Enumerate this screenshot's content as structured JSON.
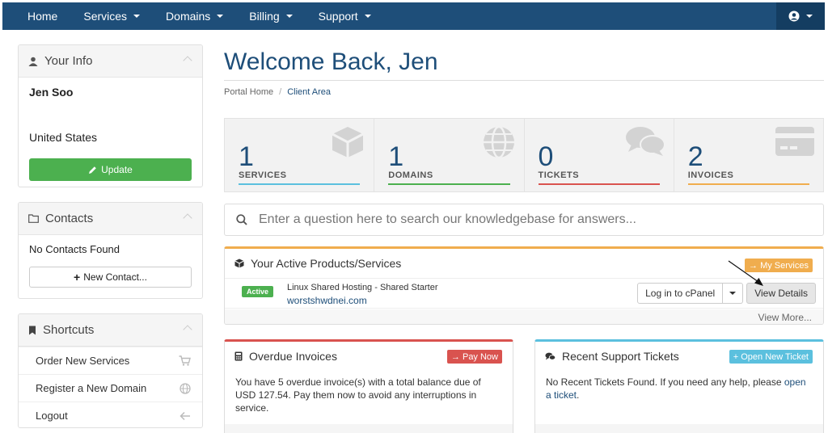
{
  "nav": {
    "items": [
      {
        "label": "Home",
        "dropdown": false
      },
      {
        "label": "Services",
        "dropdown": true
      },
      {
        "label": "Domains",
        "dropdown": true
      },
      {
        "label": "Billing",
        "dropdown": true
      },
      {
        "label": "Support",
        "dropdown": true
      }
    ],
    "account_icon": "user-circle-icon"
  },
  "sidebar": {
    "your_info": {
      "title": "Your Info",
      "name": "Jen Soo",
      "country": "United States",
      "update_label": "Update"
    },
    "contacts": {
      "title": "Contacts",
      "empty_text": "No Contacts Found",
      "new_contact_label": "New Contact..."
    },
    "shortcuts": {
      "title": "Shortcuts",
      "items": [
        {
          "label": "Order New Services",
          "icon": "cart-icon"
        },
        {
          "label": "Register a New Domain",
          "icon": "globe-icon"
        },
        {
          "label": "Logout",
          "icon": "arrow-left-icon"
        }
      ]
    }
  },
  "main": {
    "title": "Welcome Back, Jen",
    "breadcrumb": [
      "Portal Home",
      "Client Area"
    ],
    "stats": [
      {
        "count": "1",
        "label": "SERVICES",
        "color": "#5bc0de",
        "icon": "cube-icon"
      },
      {
        "count": "1",
        "label": "DOMAINS",
        "color": "#4cb04f",
        "icon": "globe-icon"
      },
      {
        "count": "0",
        "label": "TICKETS",
        "color": "#d9534f",
        "icon": "comments-icon"
      },
      {
        "count": "2",
        "label": "INVOICES",
        "color": "#f0ad4e",
        "icon": "credit-card-icon"
      }
    ],
    "kb_search": {
      "placeholder": "Enter a question here to search our knowledgebase for answers..."
    },
    "products": {
      "title": "Your Active Products/Services",
      "my_services_label": "→ My Services",
      "row": {
        "status": "Active",
        "name": "Linux Shared Hosting - Shared Starter",
        "domain": "worstshwdnei.com",
        "cpanel_label": "Log in to cPanel",
        "view_details_label": "View Details"
      },
      "view_more_label": "View More..."
    },
    "invoices": {
      "title": "Overdue Invoices",
      "pay_now_label": "→ Pay Now",
      "body": "You have 5 overdue invoice(s) with a total balance due of USD 127.54. Pay them now to avoid any interruptions in service."
    },
    "tickets": {
      "title": "Recent Support Tickets",
      "open_new_label": "+ Open New Ticket",
      "body_prefix": "No Recent Tickets Found. If you need any help, please",
      "link": "open a ticket",
      "body_suffix": "."
    }
  },
  "colors": {
    "nav_bg": "#1e4e79",
    "accent": "#1e4e79",
    "success": "#4cb04f",
    "warning": "#f0ad4e",
    "danger": "#d9534f",
    "info": "#5bc0de"
  }
}
